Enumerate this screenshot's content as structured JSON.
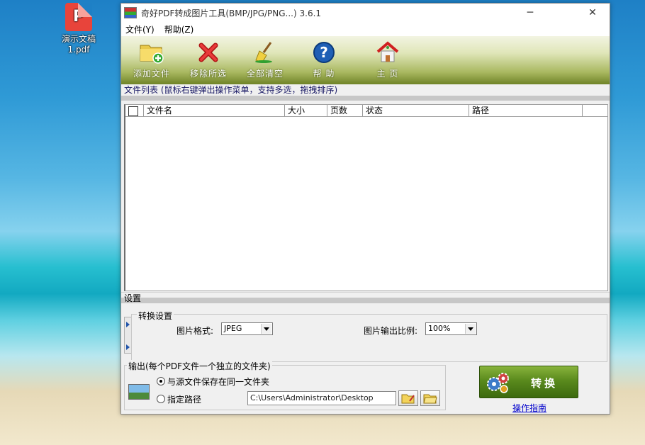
{
  "desktop": {
    "file_icon_label": "演示文稿\n1.pdf"
  },
  "window": {
    "title": "奇好PDF转成图片工具(BMP/JPG/PNG...) 3.6.1",
    "min_glyph": "─",
    "max_glyph": "☐",
    "close_glyph": "✕"
  },
  "menu": {
    "file": "文件(Y)",
    "help": "帮助(Z)"
  },
  "toolbar": {
    "add_file": "添加文件",
    "remove_selected": "移除所选",
    "clear_all": "全部清空",
    "help": "帮 助",
    "home": "主 页"
  },
  "file_list": {
    "section_title": "文件列表    (鼠标右键弹出操作菜单，支持多选，拖拽排序)",
    "columns": [
      "文件名",
      "大小",
      "页数",
      "状态",
      "路径"
    ],
    "rows": []
  },
  "settings": {
    "section_title": "设置",
    "conversion_legend": "转换设置",
    "image_format_label": "图片格式:",
    "image_format_value": "JPEG",
    "scale_label": "图片输出比例:",
    "scale_value": "100%"
  },
  "output": {
    "legend": "输出(每个PDF文件一个独立的文件夹)",
    "same_folder_label": "与源文件保存在同一文件夹",
    "custom_path_label": "指定路径",
    "path_value": "C:\\Users\\Administrator\\Desktop",
    "selected_option": "same_folder"
  },
  "actions": {
    "convert": "转换",
    "guide": "操作指南"
  },
  "colors": {
    "toolbar_dark": "#6f8327",
    "convert_green": "#5a8a1d",
    "link_blue": "#0000cc"
  }
}
